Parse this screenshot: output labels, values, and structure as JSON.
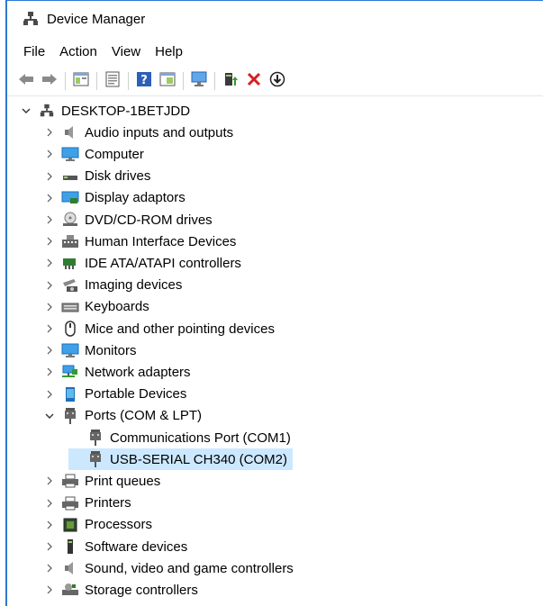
{
  "window": {
    "title": "Device Manager"
  },
  "menu": [
    "File",
    "Action",
    "View",
    "Help"
  ],
  "toolbar": [
    "back-icon",
    "forward-icon",
    "sep",
    "properties-console-icon",
    "sep",
    "update-driver-list-icon",
    "sep",
    "help-icon",
    "show-hide-icon",
    "sep",
    "scan-hardware-icon",
    "sep",
    "enable-device-icon",
    "uninstall-icon",
    "download-icon"
  ],
  "tree": {
    "root": "DESKTOP-1BETJDD",
    "categories": [
      {
        "label": "Audio inputs and outputs",
        "icon": "speaker-icon",
        "expanded": false
      },
      {
        "label": "Computer",
        "icon": "computer-icon",
        "expanded": false
      },
      {
        "label": "Disk drives",
        "icon": "disk-icon",
        "expanded": false
      },
      {
        "label": "Display adaptors",
        "icon": "display-adaptor-icon",
        "expanded": false
      },
      {
        "label": "DVD/CD-ROM drives",
        "icon": "dvd-icon",
        "expanded": false
      },
      {
        "label": "Human Interface Devices",
        "icon": "hid-icon",
        "expanded": false
      },
      {
        "label": "IDE ATA/ATAPI controllers",
        "icon": "ide-icon",
        "expanded": false
      },
      {
        "label": "Imaging devices",
        "icon": "camera-icon",
        "expanded": false
      },
      {
        "label": "Keyboards",
        "icon": "keyboard-icon",
        "expanded": false
      },
      {
        "label": "Mice and other pointing devices",
        "icon": "mouse-icon",
        "expanded": false
      },
      {
        "label": "Monitors",
        "icon": "monitor-icon",
        "expanded": false
      },
      {
        "label": "Network adapters",
        "icon": "network-icon",
        "expanded": false
      },
      {
        "label": "Portable Devices",
        "icon": "portable-icon",
        "expanded": false
      },
      {
        "label": "Ports (COM & LPT)",
        "icon": "port-icon",
        "expanded": true,
        "children": [
          {
            "label": "Communications Port (COM1)",
            "icon": "port-icon",
            "selected": false
          },
          {
            "label": "USB-SERIAL CH340 (COM2)",
            "icon": "port-icon",
            "selected": true
          }
        ]
      },
      {
        "label": "Print queues",
        "icon": "printer-icon",
        "expanded": false
      },
      {
        "label": "Printers",
        "icon": "printer-icon",
        "expanded": false
      },
      {
        "label": "Processors",
        "icon": "processor-icon",
        "expanded": false
      },
      {
        "label": "Software devices",
        "icon": "software-icon",
        "expanded": false
      },
      {
        "label": "Sound, video and game controllers",
        "icon": "speaker-icon",
        "expanded": false
      },
      {
        "label": "Storage controllers",
        "icon": "storage-icon",
        "expanded": false
      }
    ]
  },
  "colors": {
    "accent": "#2b78d4",
    "selection": "#cce8ff"
  }
}
